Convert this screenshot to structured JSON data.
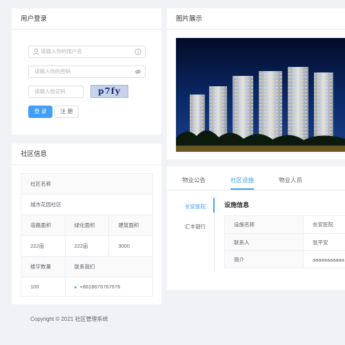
{
  "login": {
    "title": "用户登录",
    "username_placeholder": "请输入你的用户名",
    "password_placeholder": "请输入你的密码",
    "captcha_placeholder": "请输入验证码",
    "captcha_text": "p7fy",
    "login_label": "登 录",
    "register_label": "注 册"
  },
  "gallery": {
    "title": "图片展示"
  },
  "community": {
    "title": "社区信息",
    "name_label": "社区名称",
    "name_value": "城市花园社区",
    "road_area_label": "道路面积",
    "green_area_label": "绿化面积",
    "building_area_label": "建筑面积",
    "road_area_value": "222亩",
    "green_area_value": "222亩",
    "building_area_value": "3000",
    "building_count_label": "楼宇数量",
    "contact_label": "联系我们",
    "building_count_value": "100",
    "contact_value": "+8618676767676"
  },
  "tabs": [
    "物业公告",
    "社区设施",
    "物业人员"
  ],
  "facilities": {
    "side_items": [
      "长安医院",
      "汇丰银行"
    ],
    "title": "设施信息",
    "rows": [
      {
        "label": "设施名称",
        "value": "长安医院"
      },
      {
        "label": "联系人",
        "value": "张平安"
      },
      {
        "label": "简介",
        "value": "aaaaaaaaaaa"
      }
    ]
  },
  "footer": {
    "copyright": "Copyright © 2021 社区管理系统"
  },
  "colors": {
    "accent": "#409eff",
    "background": "#f0f2f5"
  }
}
